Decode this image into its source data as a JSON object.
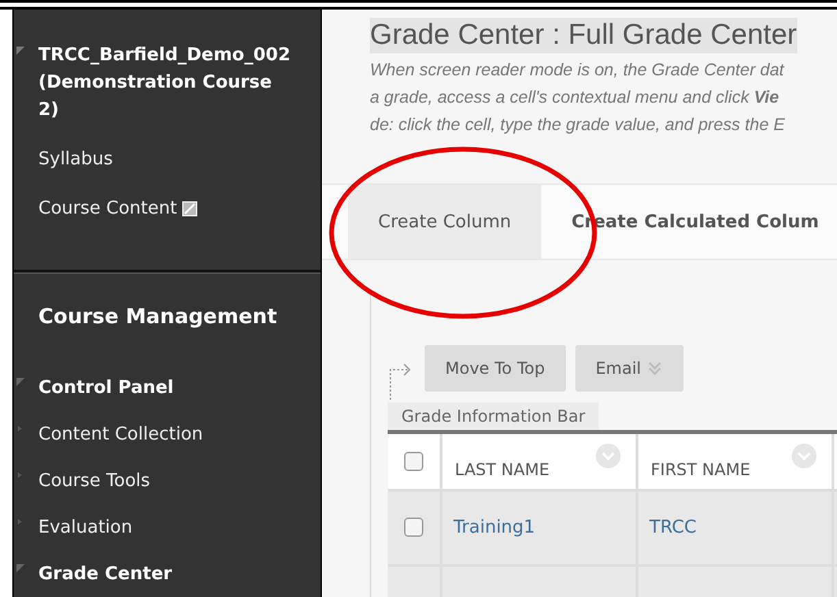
{
  "sidebar": {
    "course_title": {
      "text": "TRCC_Barfield_Demo_002 (Demonstration Course 2)",
      "expanded": true
    },
    "links": [
      {
        "label": "Syllabus",
        "has_icon": false
      },
      {
        "label": "Course Content",
        "has_icon": true
      }
    ],
    "management": {
      "heading": "Course Management",
      "items": [
        {
          "label": "Control Panel",
          "expanded": true
        },
        {
          "label": "Content Collection",
          "expanded": false
        },
        {
          "label": "Course Tools",
          "expanded": false
        },
        {
          "label": "Evaluation",
          "expanded": false
        },
        {
          "label": "Grade Center",
          "expanded": true
        }
      ]
    }
  },
  "page": {
    "title": "Grade Center : Full Grade Center",
    "description": [
      "When screen reader mode is on, the Grade Center dat",
      "a grade, access a cell's contextual menu and click **Vie**",
      "de: click the cell, type the grade value, and press the E"
    ]
  },
  "action_bar": [
    {
      "label": "Create Column",
      "selected": true
    },
    {
      "label": "Create Calculated Colum",
      "selected": false
    }
  ],
  "toolbar": {
    "buttons": [
      {
        "label": "Move To Top",
        "has_menu": false
      },
      {
        "label": "Email",
        "has_menu": true
      }
    ],
    "info_bar": "Grade Information Bar"
  },
  "table": {
    "columns": [
      "LAST NAME",
      "FIRST NAME"
    ],
    "rows": [
      {
        "checked": false,
        "cells": [
          "Training1",
          "TRCC"
        ]
      }
    ]
  },
  "header_checkbox": {
    "checked": false
  }
}
